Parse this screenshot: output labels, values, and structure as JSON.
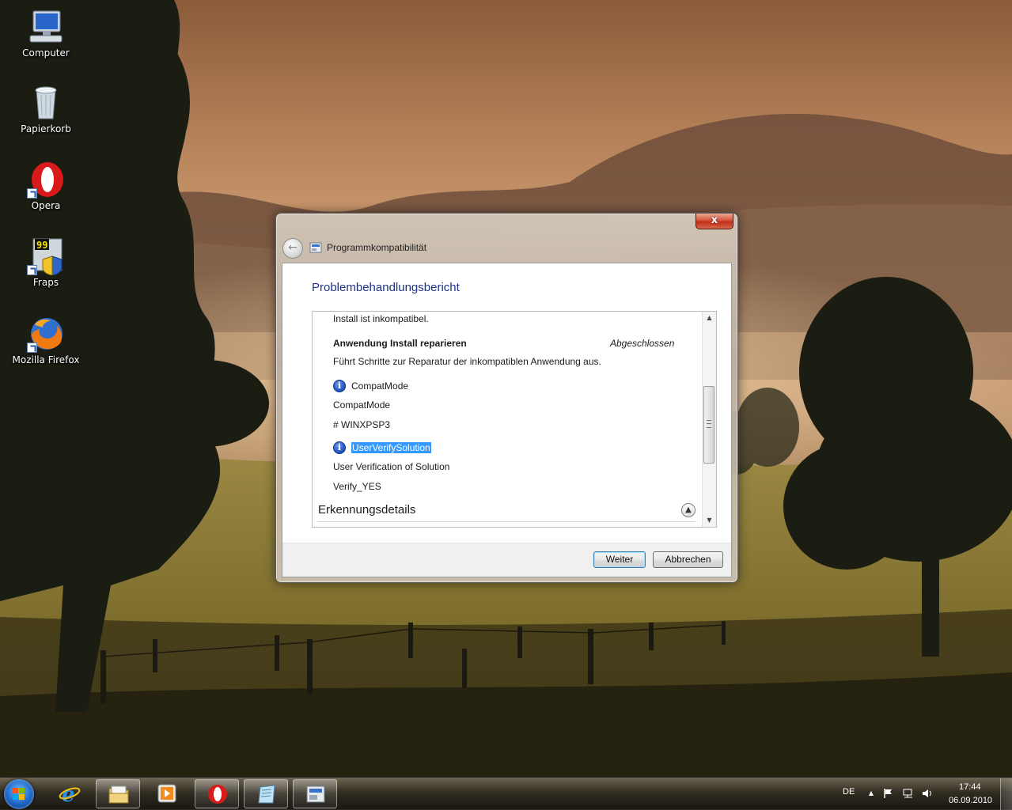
{
  "desktop": {
    "icons": [
      {
        "label": "Computer",
        "icon": "computer-icon"
      },
      {
        "label": "Papierkorb",
        "icon": "recycle-bin-icon"
      },
      {
        "label": "Opera",
        "icon": "opera-icon"
      },
      {
        "label": "Fraps",
        "icon": "fraps-icon",
        "badge": "99"
      },
      {
        "label": "Mozilla Firefox",
        "icon": "firefox-icon"
      }
    ]
  },
  "dialog": {
    "title": "Programmkompatibilität",
    "close_glyph": "x",
    "back_glyph": "←",
    "heading": "Problembehandlungsbericht",
    "report": {
      "line_top": "Install ist inkompatibel.",
      "fix_title": "Anwendung Install reparieren",
      "fix_status": "Abgeschlossen",
      "fix_description": "Führt Schritte zur Reparatur der inkompatiblen Anwendung aus.",
      "items": [
        {
          "name": "CompatMode",
          "detail": "CompatMode",
          "value": "# WINXPSP3"
        },
        {
          "name": "UserVerifySolution",
          "detail": "User Verification of Solution",
          "value": "Verify_YES",
          "selected": true
        }
      ],
      "info_glyph": "i",
      "section": "Erkennungsdetails",
      "collapse_glyph": "▲"
    },
    "scrollbar": {
      "up": "▲",
      "down": "▼"
    },
    "buttons": {
      "next": "Weiter",
      "cancel": "Abbrechen"
    }
  },
  "taskbar": {
    "pinned": [
      {
        "icon": "internet-explorer-icon"
      },
      {
        "icon": "file-explorer-icon"
      },
      {
        "icon": "media-player-icon"
      },
      {
        "icon": "opera-icon"
      },
      {
        "icon": "notepad-icon"
      },
      {
        "icon": "compatibility-window-icon"
      }
    ],
    "language": "DE",
    "tray_expand": "▲",
    "time": "17:44",
    "date": "06.09.2010"
  },
  "colors": {
    "heading": "#1e3287",
    "selection": "#3399ff",
    "close_button": "#c0301a"
  }
}
